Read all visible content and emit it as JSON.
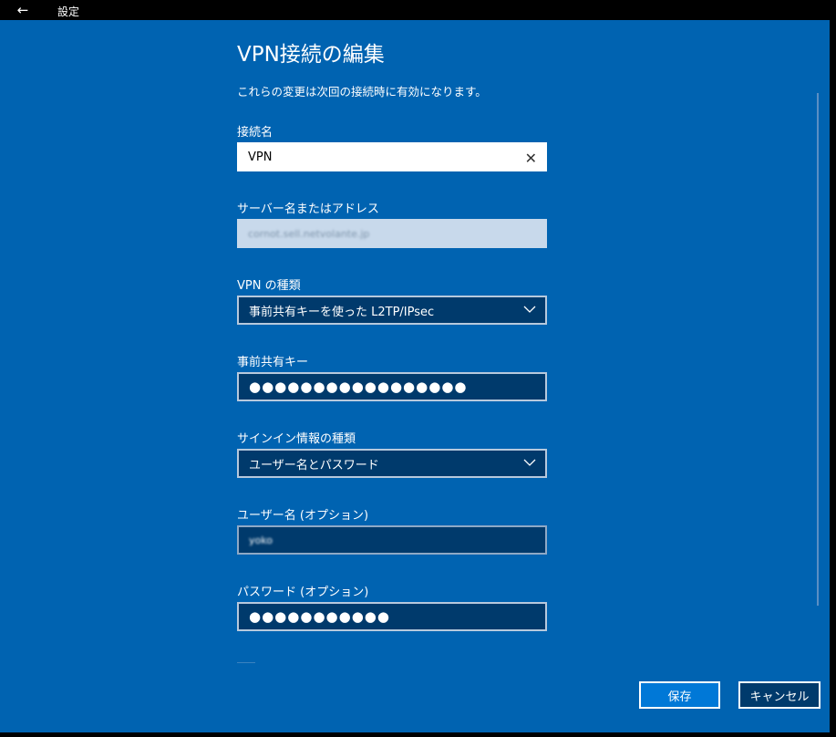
{
  "titlebar": {
    "app_title": "設定",
    "back_icon": "arrow-left-icon"
  },
  "dialog": {
    "heading": "VPN接続の編集",
    "notice": "これらの変更は次回の接続時に有効になります。"
  },
  "fields": {
    "connection_name": {
      "label": "接続名",
      "value": "VPN"
    },
    "server": {
      "label": "サーバー名またはアドレス",
      "value": "cornot.sell.netvolante.jp"
    },
    "vpn_type": {
      "label": "VPN の種類",
      "value": "事前共有キーを使った L2TP/IPsec"
    },
    "psk": {
      "label": "事前共有キー",
      "value": "●●●●●●●●●●●●●●●●●"
    },
    "signin_type": {
      "label": "サインイン情報の種類",
      "value": "ユーザー名とパスワード"
    },
    "username": {
      "label": "ユーザー名 (オプション)",
      "value": "yoko"
    },
    "password": {
      "label": "パスワード (オプション)",
      "value": "●●●●●●●●●●●"
    }
  },
  "buttons": {
    "save": "保存",
    "cancel": "キャンセル"
  },
  "colors": {
    "panel_bg": "#0063b1",
    "field_dark": "#003a6c",
    "accent": "#0078d7"
  }
}
